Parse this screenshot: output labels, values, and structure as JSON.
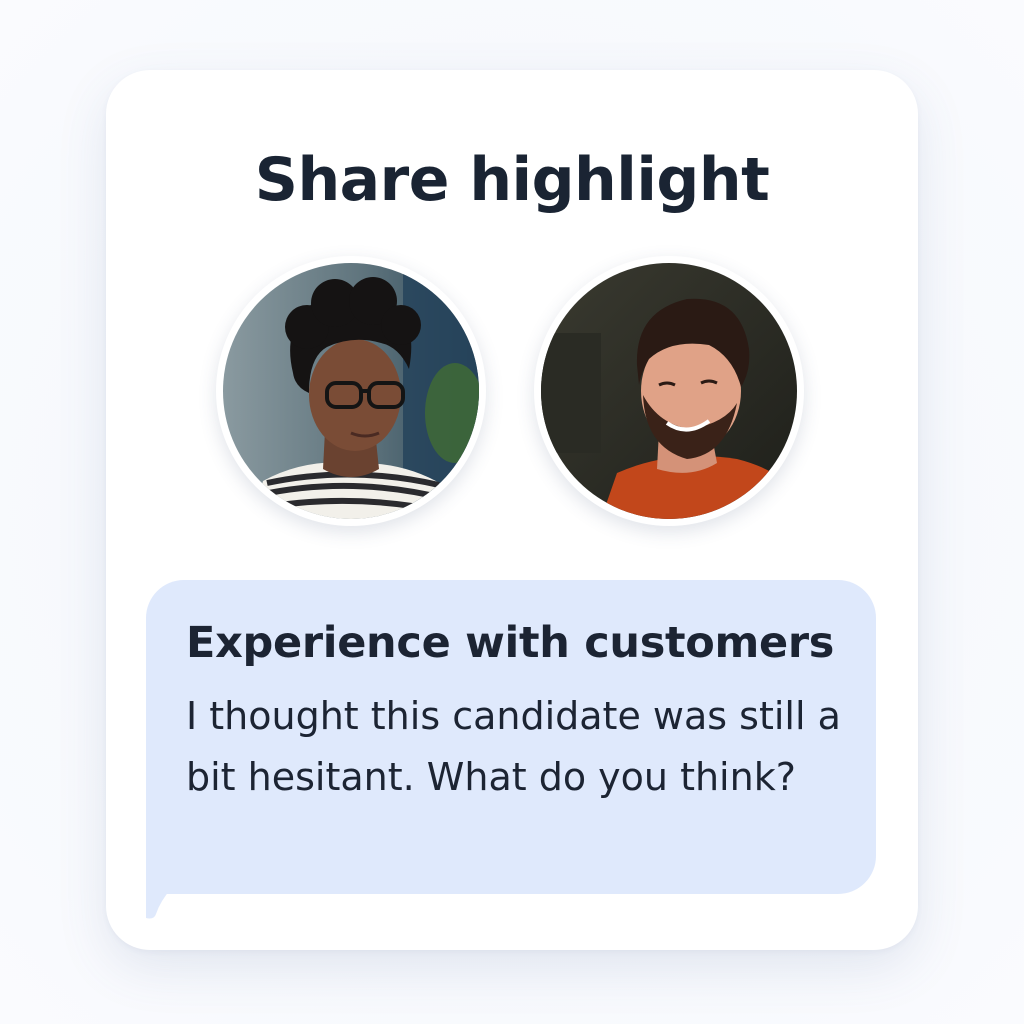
{
  "dialog": {
    "title": "Share highlight"
  },
  "participants": [
    {
      "avatar_icon": "woman-with-glasses-avatar"
    },
    {
      "avatar_icon": "bearded-man-avatar"
    }
  ],
  "message": {
    "heading": "Experience with customers",
    "body": "I thought this candidate was still a bit hesitant. What do you think?",
    "bubble_color": "#dfe9fc"
  },
  "colors": {
    "title_text": "#1a2433",
    "card_background": "#ffffff"
  }
}
